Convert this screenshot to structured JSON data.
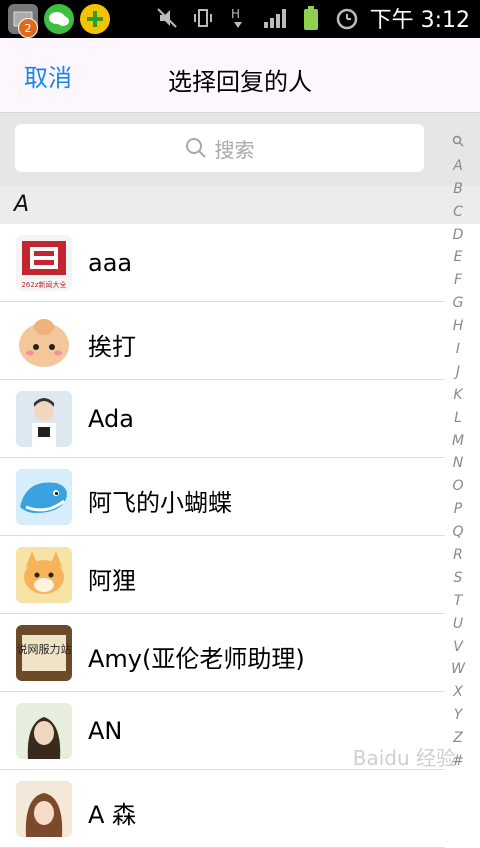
{
  "status_bar": {
    "badge": "2",
    "time": "下午 3:12"
  },
  "header": {
    "cancel_label": "取消",
    "title": "选择回复的人"
  },
  "search": {
    "placeholder": "搜索"
  },
  "section_header": "A",
  "contacts": [
    {
      "name": "aaa"
    },
    {
      "name": "挨打"
    },
    {
      "name": "Ada"
    },
    {
      "name": "阿飞的小蝴蝶"
    },
    {
      "name": "阿狸"
    },
    {
      "name": "Amy(亚伦老师助理)"
    },
    {
      "name": "AN"
    },
    {
      "name": "A 森"
    }
  ],
  "index": [
    "A",
    "B",
    "C",
    "D",
    "E",
    "F",
    "G",
    "H",
    "I",
    "J",
    "K",
    "L",
    "M",
    "N",
    "O",
    "P",
    "Q",
    "R",
    "S",
    "T",
    "U",
    "V",
    "W",
    "X",
    "Y",
    "Z",
    "#"
  ],
  "avatar_texts": {
    "aaa": "262z新闻大全",
    "amy": "说网服力站"
  },
  "watermark": "Baidu 经验",
  "colors": {
    "accent": "#1a86e6",
    "header_bg": "#fdf7fd",
    "search_bg": "#e6e6e6"
  }
}
